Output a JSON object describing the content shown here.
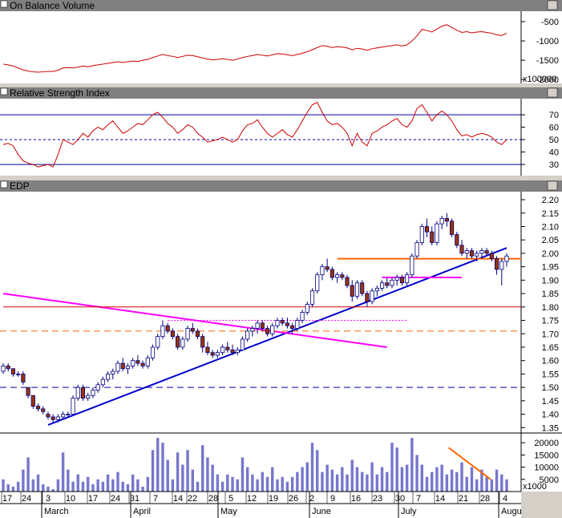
{
  "panels": {
    "obv": {
      "title": "On Balance Volume",
      "unit": "x100000",
      "ticks": [
        "-500",
        "-1000",
        "-1500",
        "-2000"
      ]
    },
    "rsi": {
      "title": "Relative Strength Index",
      "ticks": [
        "70",
        "60",
        "50",
        "40",
        "30"
      ]
    },
    "price": {
      "title": "EDP",
      "ticks": [
        "2.20",
        "2.15",
        "2.10",
        "2.05",
        "2.00",
        "1.95",
        "1.90",
        "1.85",
        "1.80",
        "1.75",
        "1.70",
        "1.65",
        "1.60",
        "1.55",
        "1.50",
        "1.45",
        "1.40",
        "1.35"
      ]
    },
    "volume": {
      "unit": "x1000",
      "ticks": [
        "20000",
        "15000",
        "10000",
        "5000"
      ]
    }
  },
  "x_axis": {
    "day_labels": [
      "17",
      "24",
      "3",
      "10",
      "17",
      "24",
      "31",
      "7",
      "14",
      "22",
      "28",
      "5",
      "12",
      "19",
      "26",
      "2",
      "9",
      "16",
      "23",
      "30",
      "7",
      "14",
      "21",
      "28",
      "4"
    ],
    "month_labels": [
      "March",
      "April",
      "May",
      "June",
      "July",
      "Augu"
    ]
  },
  "colors": {
    "obv": "#cc0000",
    "rsi": "#cc0000",
    "rsi_lines": "#0000aa",
    "candle_up": "#ffffff",
    "candle_down": "#993300",
    "candle_outline": "#000080",
    "uptrend": "#0000cc",
    "downtrend": "#ff00ff",
    "resistance": "#ff6600",
    "support_red": "#dd0000",
    "volume_bar": "#7777cc"
  },
  "chart_data": {
    "type": "line",
    "x_axis_kind": "trading days, mid-February through early August",
    "price_range": [
      1.33,
      2.23
    ],
    "rsi_range": [
      21,
      83
    ],
    "obv_range": [
      -2100,
      -230
    ],
    "volume_range": [
      0,
      24000
    ],
    "price_ohlc": [
      [
        1.56,
        1.59,
        1.55,
        1.58
      ],
      [
        1.58,
        1.59,
        1.56,
        1.57
      ],
      [
        1.57,
        1.57,
        1.54,
        1.55
      ],
      [
        1.55,
        1.56,
        1.54,
        1.55
      ],
      [
        1.55,
        1.56,
        1.51,
        1.52
      ],
      [
        1.5,
        1.5,
        1.46,
        1.47
      ],
      [
        1.47,
        1.47,
        1.42,
        1.43
      ],
      [
        1.43,
        1.44,
        1.41,
        1.42
      ],
      [
        1.42,
        1.43,
        1.4,
        1.41
      ],
      [
        1.4,
        1.41,
        1.38,
        1.39
      ],
      [
        1.39,
        1.4,
        1.37,
        1.38
      ],
      [
        1.38,
        1.4,
        1.37,
        1.39
      ],
      [
        1.39,
        1.41,
        1.38,
        1.4
      ],
      [
        1.4,
        1.41,
        1.39,
        1.4
      ],
      [
        1.4,
        1.47,
        1.4,
        1.46
      ],
      [
        1.46,
        1.51,
        1.45,
        1.5
      ],
      [
        1.5,
        1.51,
        1.45,
        1.46
      ],
      [
        1.46,
        1.48,
        1.45,
        1.47
      ],
      [
        1.47,
        1.5,
        1.46,
        1.49
      ],
      [
        1.49,
        1.52,
        1.48,
        1.51
      ],
      [
        1.51,
        1.54,
        1.5,
        1.53
      ],
      [
        1.53,
        1.56,
        1.52,
        1.55
      ],
      [
        1.55,
        1.57,
        1.53,
        1.56
      ],
      [
        1.56,
        1.6,
        1.55,
        1.59
      ],
      [
        1.59,
        1.61,
        1.56,
        1.57
      ],
      [
        1.57,
        1.59,
        1.55,
        1.58
      ],
      [
        1.58,
        1.61,
        1.57,
        1.6
      ],
      [
        1.6,
        1.62,
        1.58,
        1.59
      ],
      [
        1.59,
        1.6,
        1.57,
        1.58
      ],
      [
        1.58,
        1.62,
        1.57,
        1.61
      ],
      [
        1.61,
        1.66,
        1.6,
        1.65
      ],
      [
        1.65,
        1.7,
        1.64,
        1.69
      ],
      [
        1.69,
        1.75,
        1.68,
        1.73
      ],
      [
        1.73,
        1.74,
        1.7,
        1.71
      ],
      [
        1.71,
        1.72,
        1.68,
        1.69
      ],
      [
        1.69,
        1.7,
        1.64,
        1.65
      ],
      [
        1.65,
        1.69,
        1.64,
        1.68
      ],
      [
        1.68,
        1.73,
        1.67,
        1.72
      ],
      [
        1.72,
        1.74,
        1.7,
        1.71
      ],
      [
        1.71,
        1.72,
        1.68,
        1.69
      ],
      [
        1.69,
        1.7,
        1.63,
        1.65
      ],
      [
        1.65,
        1.67,
        1.62,
        1.63
      ],
      [
        1.63,
        1.64,
        1.61,
        1.62
      ],
      [
        1.62,
        1.64,
        1.61,
        1.63
      ],
      [
        1.63,
        1.66,
        1.62,
        1.65
      ],
      [
        1.65,
        1.67,
        1.63,
        1.64
      ],
      [
        1.64,
        1.66,
        1.62,
        1.63
      ],
      [
        1.63,
        1.65,
        1.62,
        1.64
      ],
      [
        1.64,
        1.69,
        1.64,
        1.68
      ],
      [
        1.68,
        1.72,
        1.67,
        1.71
      ],
      [
        1.71,
        1.73,
        1.69,
        1.72
      ],
      [
        1.72,
        1.75,
        1.7,
        1.74
      ],
      [
        1.74,
        1.75,
        1.71,
        1.72
      ],
      [
        1.72,
        1.73,
        1.69,
        1.7
      ],
      [
        1.7,
        1.74,
        1.69,
        1.73
      ],
      [
        1.73,
        1.76,
        1.72,
        1.75
      ],
      [
        1.75,
        1.76,
        1.73,
        1.74
      ],
      [
        1.74,
        1.76,
        1.72,
        1.73
      ],
      [
        1.73,
        1.74,
        1.7,
        1.72
      ],
      [
        1.72,
        1.76,
        1.71,
        1.75
      ],
      [
        1.75,
        1.79,
        1.74,
        1.78
      ],
      [
        1.78,
        1.82,
        1.77,
        1.81
      ],
      [
        1.81,
        1.87,
        1.8,
        1.86
      ],
      [
        1.86,
        1.93,
        1.85,
        1.92
      ],
      [
        1.92,
        1.96,
        1.9,
        1.95
      ],
      [
        1.95,
        1.98,
        1.93,
        1.94
      ],
      [
        1.94,
        1.95,
        1.9,
        1.91
      ],
      [
        1.91,
        1.93,
        1.89,
        1.92
      ],
      [
        1.92,
        1.93,
        1.9,
        1.91
      ],
      [
        1.91,
        1.92,
        1.87,
        1.88
      ],
      [
        1.88,
        1.9,
        1.82,
        1.84
      ],
      [
        1.84,
        1.9,
        1.83,
        1.89
      ],
      [
        1.89,
        1.9,
        1.84,
        1.85
      ],
      [
        1.85,
        1.86,
        1.8,
        1.82
      ],
      [
        1.82,
        1.87,
        1.81,
        1.86
      ],
      [
        1.86,
        1.88,
        1.84,
        1.87
      ],
      [
        1.87,
        1.9,
        1.86,
        1.89
      ],
      [
        1.89,
        1.91,
        1.87,
        1.88
      ],
      [
        1.88,
        1.91,
        1.87,
        1.9
      ],
      [
        1.9,
        1.92,
        1.88,
        1.91
      ],
      [
        1.91,
        1.92,
        1.88,
        1.89
      ],
      [
        1.89,
        1.93,
        1.88,
        1.92
      ],
      [
        1.92,
        2.0,
        1.91,
        1.99
      ],
      [
        1.99,
        2.05,
        1.98,
        2.04
      ],
      [
        2.04,
        2.11,
        2.03,
        2.1
      ],
      [
        2.1,
        2.13,
        2.06,
        2.08
      ],
      [
        2.08,
        2.1,
        2.03,
        2.04
      ],
      [
        2.04,
        2.12,
        2.03,
        2.11
      ],
      [
        2.11,
        2.14,
        2.09,
        2.13
      ],
      [
        2.13,
        2.15,
        2.1,
        2.12
      ],
      [
        2.12,
        2.13,
        2.06,
        2.07
      ],
      [
        2.07,
        2.08,
        2.02,
        2.03
      ],
      [
        2.03,
        2.05,
        1.99,
        2.0
      ],
      [
        2.0,
        2.02,
        1.98,
        2.01
      ],
      [
        2.01,
        2.02,
        1.98,
        1.99
      ],
      [
        1.99,
        2.01,
        1.97,
        2.0
      ],
      [
        2.0,
        2.02,
        1.98,
        2.01
      ],
      [
        2.01,
        2.02,
        1.99,
        2.0
      ],
      [
        2.0,
        2.01,
        1.97,
        1.98
      ],
      [
        1.98,
        1.99,
        1.92,
        1.94
      ],
      [
        1.94,
        1.98,
        1.88,
        1.97
      ],
      [
        1.97,
        2.0,
        1.95,
        1.99
      ]
    ],
    "rsi_values": [
      46,
      47,
      45,
      38,
      33,
      31,
      30,
      28,
      29,
      30,
      28,
      38,
      50,
      48,
      46,
      50,
      55,
      52,
      57,
      60,
      58,
      62,
      65,
      60,
      55,
      57,
      60,
      63,
      62,
      66,
      70,
      72,
      68,
      63,
      60,
      55,
      58,
      62,
      60,
      55,
      52,
      48,
      49,
      50,
      52,
      50,
      48,
      50,
      57,
      62,
      63,
      66,
      60,
      55,
      52,
      55,
      58,
      54,
      52,
      58,
      65,
      72,
      78,
      80,
      72,
      65,
      62,
      63,
      60,
      55,
      45,
      55,
      48,
      45,
      55,
      57,
      60,
      62,
      65,
      67,
      62,
      60,
      65,
      75,
      78,
      72,
      65,
      70,
      73,
      70,
      65,
      58,
      53,
      54,
      52,
      54,
      55,
      54,
      52,
      48,
      46,
      50
    ],
    "obv_values": [
      -1600,
      -1620,
      -1650,
      -1700,
      -1750,
      -1780,
      -1800,
      -1810,
      -1800,
      -1790,
      -1790,
      -1760,
      -1700,
      -1690,
      -1700,
      -1680,
      -1650,
      -1670,
      -1640,
      -1620,
      -1600,
      -1580,
      -1560,
      -1540,
      -1560,
      -1540,
      -1520,
      -1530,
      -1500,
      -1480,
      -1430,
      -1390,
      -1350,
      -1380,
      -1400,
      -1430,
      -1400,
      -1370,
      -1380,
      -1410,
      -1440,
      -1470,
      -1490,
      -1480,
      -1460,
      -1480,
      -1500,
      -1470,
      -1430,
      -1400,
      -1380,
      -1350,
      -1370,
      -1390,
      -1360,
      -1330,
      -1340,
      -1360,
      -1380,
      -1350,
      -1320,
      -1280,
      -1230,
      -1170,
      -1120,
      -1140,
      -1170,
      -1150,
      -1160,
      -1180,
      -1230,
      -1190,
      -1210,
      -1240,
      -1200,
      -1180,
      -1160,
      -1140,
      -1120,
      -1100,
      -1130,
      -1100,
      -1000,
      -870,
      -700,
      -730,
      -770,
      -690,
      -620,
      -580,
      -650,
      -720,
      -780,
      -760,
      -790,
      -770,
      -760,
      -780,
      -800,
      -840,
      -860,
      -800
    ],
    "volume_values": [
      5000,
      3000,
      2000,
      4000,
      9000,
      14000,
      5000,
      7000,
      3000,
      2000,
      1000,
      5000,
      16000,
      9000,
      4000,
      7000,
      4000,
      6000,
      3000,
      5000,
      4000,
      7000,
      5000,
      8000,
      4000,
      3000,
      7000,
      5000,
      2000,
      6000,
      17000,
      22000,
      20000,
      13000,
      5000,
      16000,
      11000,
      17000,
      9000,
      4000,
      19000,
      14000,
      11000,
      7000,
      4000,
      7000,
      6000,
      5000,
      14000,
      10000,
      7000,
      5000,
      8000,
      6000,
      10000,
      5000,
      6000,
      4000,
      6000,
      8000,
      10000,
      12000,
      20000,
      17000,
      8000,
      11000,
      9000,
      7000,
      10000,
      7000,
      13000,
      10000,
      8000,
      7000,
      12000,
      7000,
      10000,
      8000,
      20000,
      18000,
      10000,
      11000,
      22000,
      15000,
      11000,
      6000,
      8000,
      10000,
      11000,
      7000,
      9000,
      8000,
      12000,
      6000,
      10000,
      5000,
      9000,
      6000,
      5000,
      9000,
      7000,
      5000
    ],
    "trendlines": [
      {
        "kind": "uptrend",
        "from": [
          9,
          1.36
        ],
        "to": [
          101,
          2.02
        ]
      },
      {
        "kind": "downtrend",
        "from": [
          0,
          1.85
        ],
        "to": [
          77,
          1.65
        ]
      },
      {
        "kind": "horizontal",
        "level": 1.98,
        "from_day": 67,
        "to_day": 101
      },
      {
        "kind": "horizontal",
        "level": 1.91,
        "from_day": 76,
        "to_day": 92
      },
      {
        "kind": "horizontal",
        "level": 1.8,
        "from_day": 0,
        "to_day": 101
      },
      {
        "kind": "dashed",
        "level": 1.71,
        "from_day": 0,
        "to_day": 101
      },
      {
        "kind": "dashed",
        "level": 1.5,
        "from_day": 0,
        "to_day": 101
      },
      {
        "kind": "dotted",
        "level": 1.75,
        "from_day": 33,
        "to_day": 81
      },
      {
        "kind": "volume_divergence",
        "from": [
          99,
          18000
        ],
        "to": [
          101,
          5000
        ]
      }
    ]
  }
}
